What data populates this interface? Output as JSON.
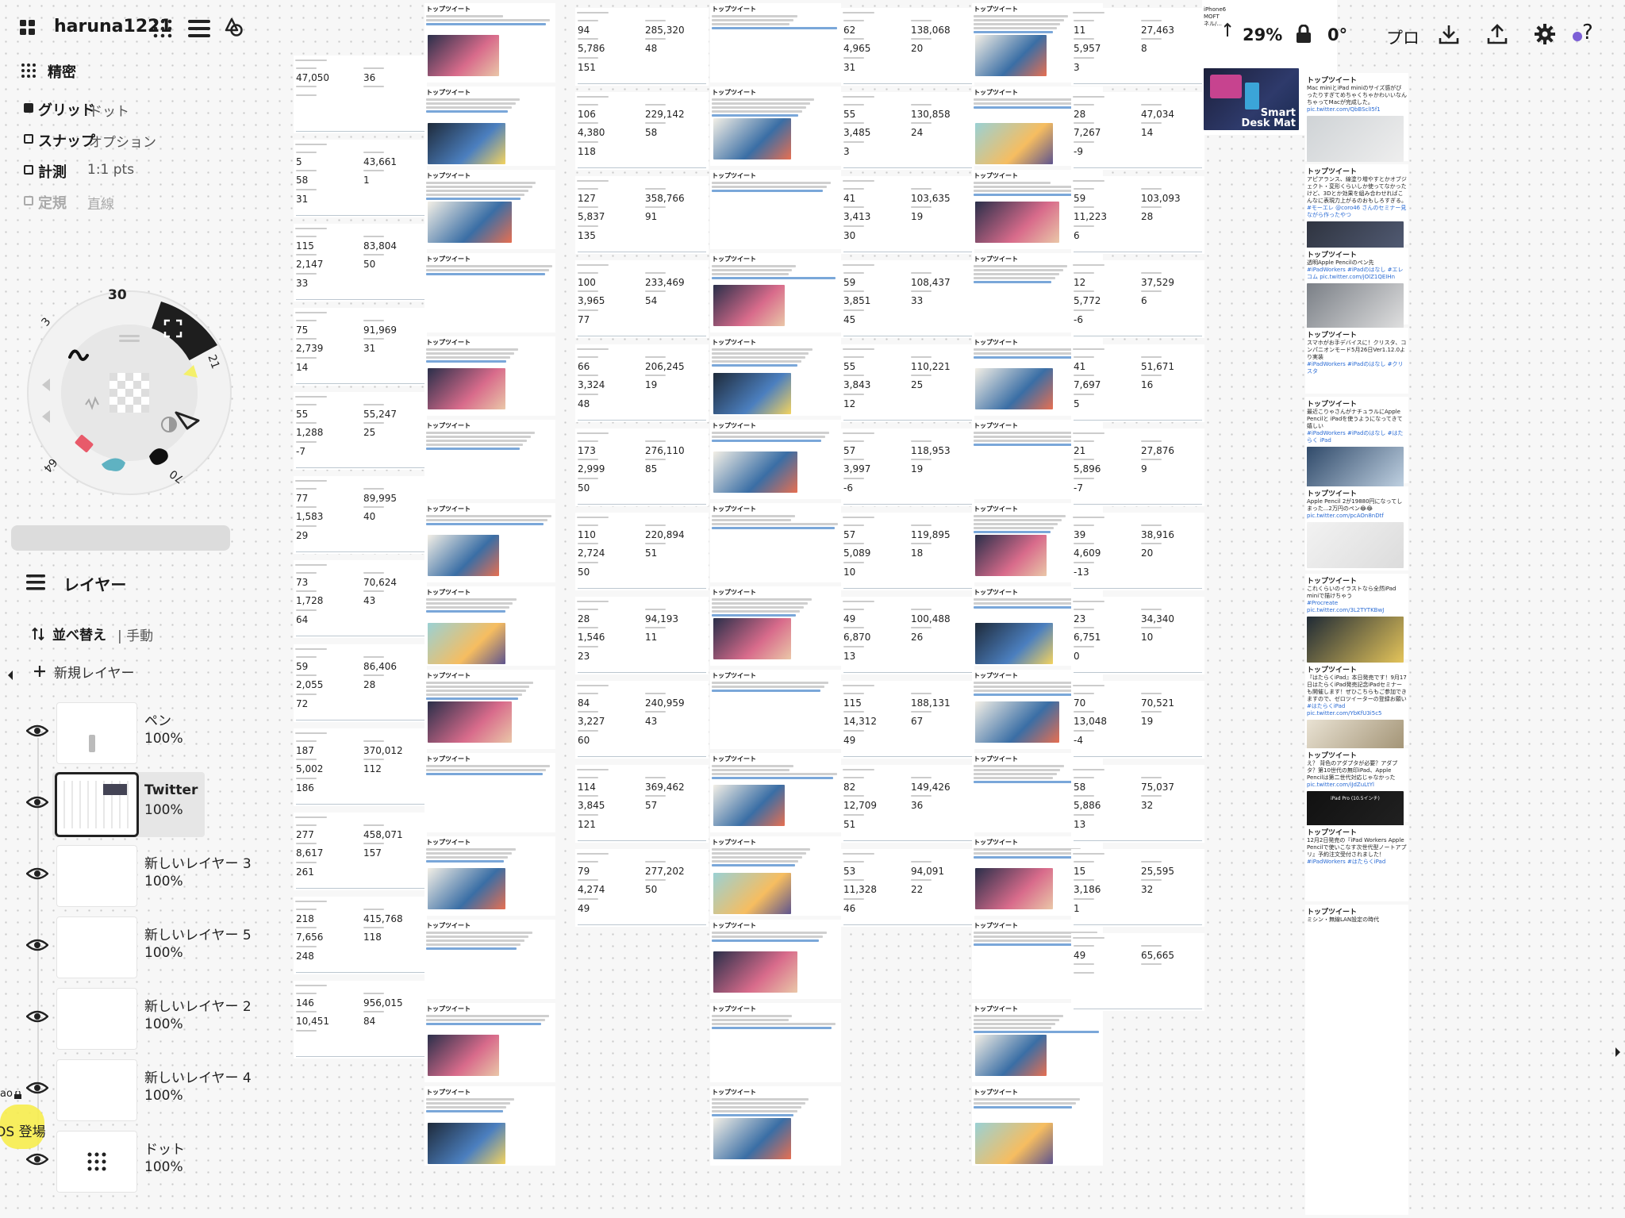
{
  "app": {
    "username": "haruna1221",
    "grid_mode": "精密",
    "zoom": "29%",
    "rotation": "0°",
    "mode_label": "プロ",
    "help_label": "?"
  },
  "settings": {
    "grid_label": "グリッド",
    "grid_value": "ドット",
    "snap_label": "スナップ",
    "snap_value": "オプション",
    "measure_label": "計測",
    "measure_value": "1:1 pts",
    "ruler_label": "定規",
    "ruler_value": "直線"
  },
  "wheel": {
    "top_size": "30",
    "left_size": "3",
    "right_size": "21",
    "bottom_right": "70",
    "bottom_left": "64"
  },
  "layers": {
    "title": "レイヤー",
    "sort_label": "並べ替え",
    "sort_value": "| 手動",
    "new_layer": "新規レイヤー",
    "items": [
      {
        "name": "ペン",
        "opacity": "100%"
      },
      {
        "name": "Twitter",
        "opacity": "100%"
      },
      {
        "name": "新しいレイヤー 3",
        "opacity": "100%"
      },
      {
        "name": "新しいレイヤー 5",
        "opacity": "100%"
      },
      {
        "name": "新しいレイヤー 2",
        "opacity": "100%"
      },
      {
        "name": "新しいレイヤー 4",
        "opacity": "100%"
      },
      {
        "name": "ドット",
        "opacity": "100%"
      }
    ]
  },
  "sticker": {
    "top": "ao",
    "bottom": "OS 登場"
  },
  "canvas": {
    "tweet_label": "トップツイート",
    "stat_columns": [
      {
        "cards": [
          [
            "47,050",
            "36",
            "",
            ""
          ],
          [
            "5",
            "43,661",
            "58",
            "1"
          ],
          [
            "115",
            "83,804",
            "2,147",
            "50"
          ],
          [
            "75",
            "91,969",
            "2,739",
            "31"
          ],
          [
            "55",
            "55,247",
            "1,288",
            "25"
          ],
          [
            "77",
            "89,995",
            "1,583",
            "40"
          ],
          [
            "73",
            "70,624",
            "1,728",
            "43"
          ],
          [
            "59",
            "86,406",
            "2,055",
            "28"
          ],
          [
            "187",
            "370,012",
            "5,002",
            "112"
          ],
          [
            "277",
            "458,071",
            "8,617",
            "157"
          ],
          [
            "218",
            "415,768",
            "7,656",
            "118"
          ],
          [
            "146",
            "956,015",
            "10,451",
            "84"
          ]
        ],
        "extras": [
          "",
          "31",
          "33",
          "14",
          "-7",
          "29",
          "64",
          "72",
          "186",
          "261",
          "248",
          ""
        ]
      },
      {
        "cards": [
          [
            "94",
            "285,320",
            "5,786",
            "48"
          ],
          [
            "106",
            "229,142",
            "4,380",
            "58"
          ],
          [
            "127",
            "358,766",
            "5,837",
            "91"
          ],
          [
            "100",
            "233,469",
            "3,965",
            "54"
          ],
          [
            "66",
            "206,245",
            "3,324",
            "19"
          ],
          [
            "173",
            "276,110",
            "2,999",
            "85"
          ],
          [
            "110",
            "220,894",
            "2,724",
            "51"
          ],
          [
            "28",
            "94,193",
            "1,546",
            "11"
          ],
          [
            "84",
            "240,959",
            "3,227",
            "43"
          ],
          [
            "114",
            "369,462",
            "3,845",
            "57"
          ],
          [
            "79",
            "277,202",
            "4,274",
            "50"
          ]
        ],
        "extras": [
          "151",
          "118",
          "135",
          "77",
          "48",
          "50",
          "50",
          "23",
          "60",
          "121",
          "49"
        ]
      },
      {
        "cards": [
          [
            "62",
            "138,068",
            "4,965",
            "20"
          ],
          [
            "55",
            "130,858",
            "3,485",
            "24"
          ],
          [
            "41",
            "103,635",
            "3,413",
            "19"
          ],
          [
            "59",
            "108,437",
            "3,851",
            "33"
          ],
          [
            "55",
            "110,221",
            "3,843",
            "25"
          ],
          [
            "57",
            "118,953",
            "3,997",
            "19"
          ],
          [
            "57",
            "119,895",
            "5,089",
            "18"
          ],
          [
            "49",
            "100,488",
            "6,870",
            "26"
          ],
          [
            "115",
            "188,131",
            "14,312",
            "67"
          ],
          [
            "82",
            "149,426",
            "12,709",
            "36"
          ],
          [
            "53",
            "94,091",
            "11,328",
            "22"
          ]
        ],
        "extras": [
          "31",
          "3",
          "30",
          "45",
          "12",
          "-6",
          "10",
          "13",
          "49",
          "51",
          "46"
        ]
      },
      {
        "cards": [
          [
            "11",
            "27,463",
            "5,957",
            "8"
          ],
          [
            "28",
            "47,034",
            "7,267",
            "14"
          ],
          [
            "59",
            "103,093",
            "11,223",
            "28"
          ],
          [
            "12",
            "37,529",
            "5,772",
            "6"
          ],
          [
            "41",
            "51,671",
            "7,697",
            "16"
          ],
          [
            "21",
            "27,876",
            "5,896",
            "9"
          ],
          [
            "39",
            "38,916",
            "4,609",
            "20"
          ],
          [
            "23",
            "34,340",
            "6,751",
            "10"
          ],
          [
            "70",
            "70,521",
            "13,048",
            "19"
          ],
          [
            "58",
            "75,037",
            "5,886",
            "32"
          ],
          [
            "15",
            "25,595",
            "3,186",
            "32"
          ],
          [
            "49",
            "65,665",
            "",
            ""
          ]
        ],
        "extras": [
          "3",
          "-9",
          "6",
          "-6",
          "5",
          "-7",
          "-13",
          "0",
          "-4",
          "13",
          "1",
          ""
        ]
      }
    ],
    "right_col": {
      "header_left": "iPhone6\nMOFT\nネル/...",
      "cards": [
        {
          "title": "トップツイート",
          "body": "Mac miniとiPad miniのサイズ感がぴったりすぎてめちゃくちゃかわいいなんちゃってMacが完成した。",
          "link": "pic.twitter.com/QbBSclI5f1"
        },
        {
          "title": "トップツイート",
          "body": "アピアランス、線塗り増やすとかオブジェクト・変形くらいしか使ってなかったけど、3Dとか効果を組み合わせればこんなに表現力上がるのおもしろすぎる。",
          "link": "#モーエレ @coro46 さんのセミナー見ながら作ったやつ pic.twitter.com/OPlEnBW1qX"
        },
        {
          "title": "トップツイート",
          "body": "透明Apple Pencilのペン先",
          "link": "#iPadWorkers #iPadのはなし #エレコム pic.twitter.com/jOlZ1QEIHn"
        },
        {
          "title": "トップツイート",
          "body": "スマホがお手デバイスに！クリスタ、コンパニオンモード5月26日Ver1.12.0より実装",
          "link": "#iPadWorkers #iPadのはなし #クリスタ"
        },
        {
          "title": "トップツイート",
          "body": "最近こりゃさんがナチュラルにApple Pencilと iPadを使うようになってきて嬉しい",
          "link": "#iPadWorkers #iPadのはなし #はたらく iPad pic.twitter.com/dNDQr5zpp"
        },
        {
          "title": "トップツイート",
          "body": "Apple Pencil 2が19880円になってしまった...2万円のペン😂😂",
          "link": "pic.twitter.com/pcAOn8nDtf"
        },
        {
          "title": "トップツイート",
          "body": "これくらいのイラストなら全然iPad miniで描けちゃう",
          "link": "#Procreate pic.twitter.com/3L2TYTKBwJ"
        },
        {
          "title": "トップツイート",
          "body": "『はたらくiPad』本日発売です！9月17日はたらくiPad発売記念iPadセミナーも開催します！ぜひこちらもご参加できますので、ゼロツイーターの登録お願いします",
          "link": "#はたらくiPad pic.twitter.com/YbKfU3i5c5"
        },
        {
          "title": "トップツイート",
          "body": "え？ 背色のアダプタが必要？アダプタ？第10世代の無印iPad、Apple Pencilは第二世代対応じゃなかった",
          "link": "pic.twitter.com/iJdZuLtYl"
        },
        {
          "title": "トップツイート",
          "body": "12月2日発売の『iPad Workers Apple Pencilで使いこなす次世代型ノートアプリ』予約注文受付されました！",
          "link": "#iPadWorkers #はたらくiPad"
        },
        {
          "title": "トップツイート",
          "body": "ミシン・無線LAN設定の時代",
          "link": ""
        }
      ],
      "moft_text": "Smart\nDesk Mat",
      "ipad_text": "iPad Pro (10.5インチ)"
    }
  }
}
